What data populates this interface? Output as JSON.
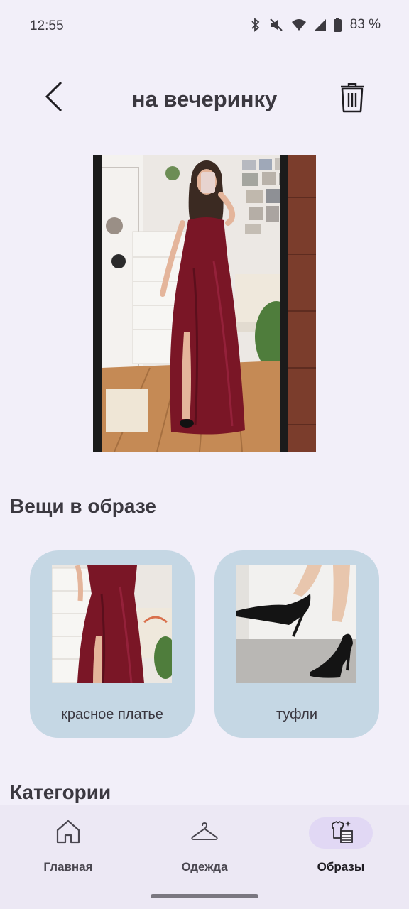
{
  "status_bar": {
    "time": "12:55",
    "battery_percent": "83 %",
    "icons": [
      "bluetooth-icon",
      "mute-icon",
      "wifi-icon",
      "signal-icon",
      "battery-icon"
    ]
  },
  "header": {
    "title": "на вечеринку",
    "back_icon": "chevron-left-icon",
    "delete_icon": "trash-icon"
  },
  "outfit": {
    "photo_alt": "outfit-photo"
  },
  "items_section": {
    "title": "Вещи в образе",
    "items": [
      {
        "label": "красное платье",
        "image": "dress-photo"
      },
      {
        "label": "туфли",
        "image": "shoes-photo"
      }
    ]
  },
  "categories_section": {
    "title": "Категории"
  },
  "bottom_nav": {
    "items": [
      {
        "label": "Главная",
        "icon": "home-icon",
        "active": false
      },
      {
        "label": "Одежда",
        "icon": "hanger-icon",
        "active": false
      },
      {
        "label": "Образы",
        "icon": "outfits-icon",
        "active": true
      }
    ]
  },
  "colors": {
    "background": "#f2eff9",
    "card": "#c5d7e4",
    "nav_active": "#e1d8f4",
    "dress": "#7a1626"
  }
}
